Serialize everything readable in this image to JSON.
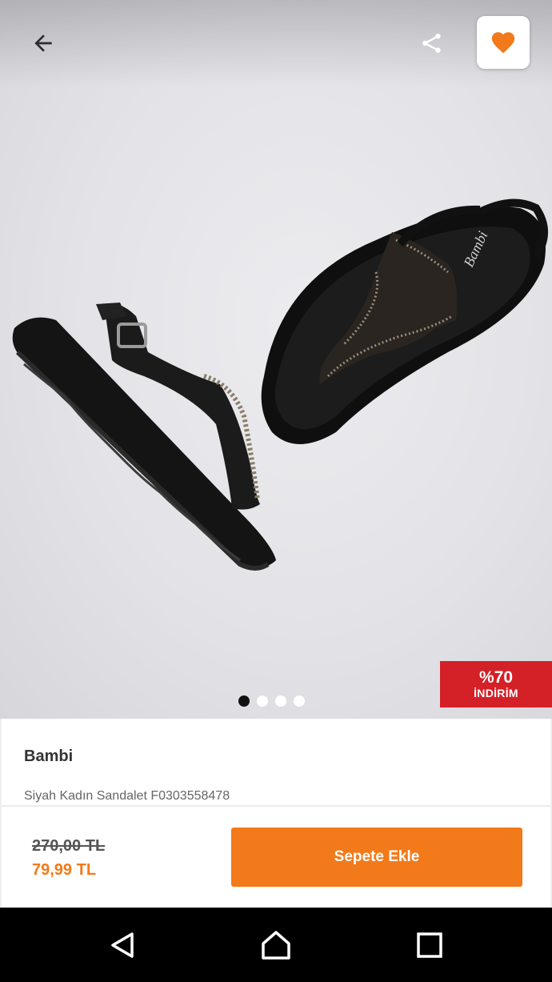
{
  "app": {
    "accent_color": "#f27a1a",
    "badge_color": "#d42027"
  },
  "header": {
    "back_icon": "arrow-left-icon",
    "share_icon": "share-icon",
    "favorite_icon": "heart-icon",
    "favorite_active": true
  },
  "gallery": {
    "image_count": 4,
    "active_index": 0
  },
  "discount": {
    "percent": "%70",
    "label": "İNDİRİM"
  },
  "product": {
    "brand": "Bambi",
    "name": "Siyah Kadın Sandalet F0303558478"
  },
  "pricing": {
    "old_price": "270,00 TL",
    "new_price": "79,99 TL",
    "add_to_cart_label": "Sepete Ekle"
  },
  "system_nav": {
    "back_icon": "triangle-back-icon",
    "home_icon": "home-icon",
    "recents_icon": "square-recents-icon"
  }
}
